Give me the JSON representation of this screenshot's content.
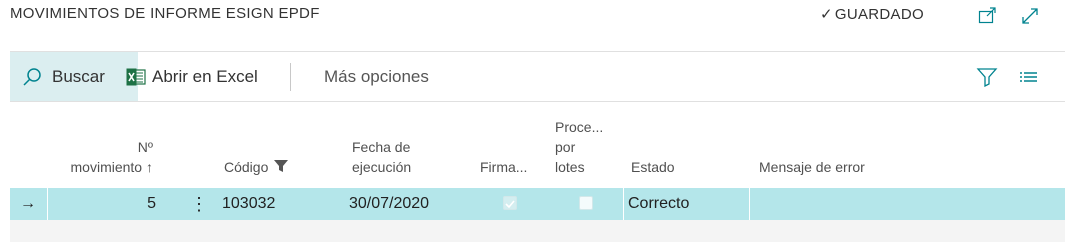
{
  "header": {
    "title": "MOVIMIENTOS DE INFORME ESIGN EPDF",
    "saved_check": "✓",
    "saved_label": "GUARDADO"
  },
  "toolbar": {
    "search_label": "Buscar",
    "excel_label": "Abrir en Excel",
    "more_label": "Más opciones"
  },
  "columns": {
    "num_line1": "Nº",
    "num_line2": "movimiento",
    "num_sort": "↑",
    "codigo": "Código",
    "fecha_line1": "Fecha de",
    "fecha_line2": "ejecución",
    "firma": "Firma...",
    "proce_line1": "Proce...",
    "proce_line2": "por",
    "proce_line3": "lotes",
    "estado": "Estado",
    "mensaje": "Mensaje de error"
  },
  "rows": [
    {
      "indicator": "→",
      "num": "5",
      "menu": "⋮",
      "codigo": "103032",
      "fecha": "30/07/2020",
      "firma_checked": true,
      "proce_checked": false,
      "estado": "Correcto",
      "mensaje": ""
    }
  ],
  "colors": {
    "selected_row": "#b4e6ea",
    "accent": "#00838f",
    "excel_green": "#1e7145"
  }
}
